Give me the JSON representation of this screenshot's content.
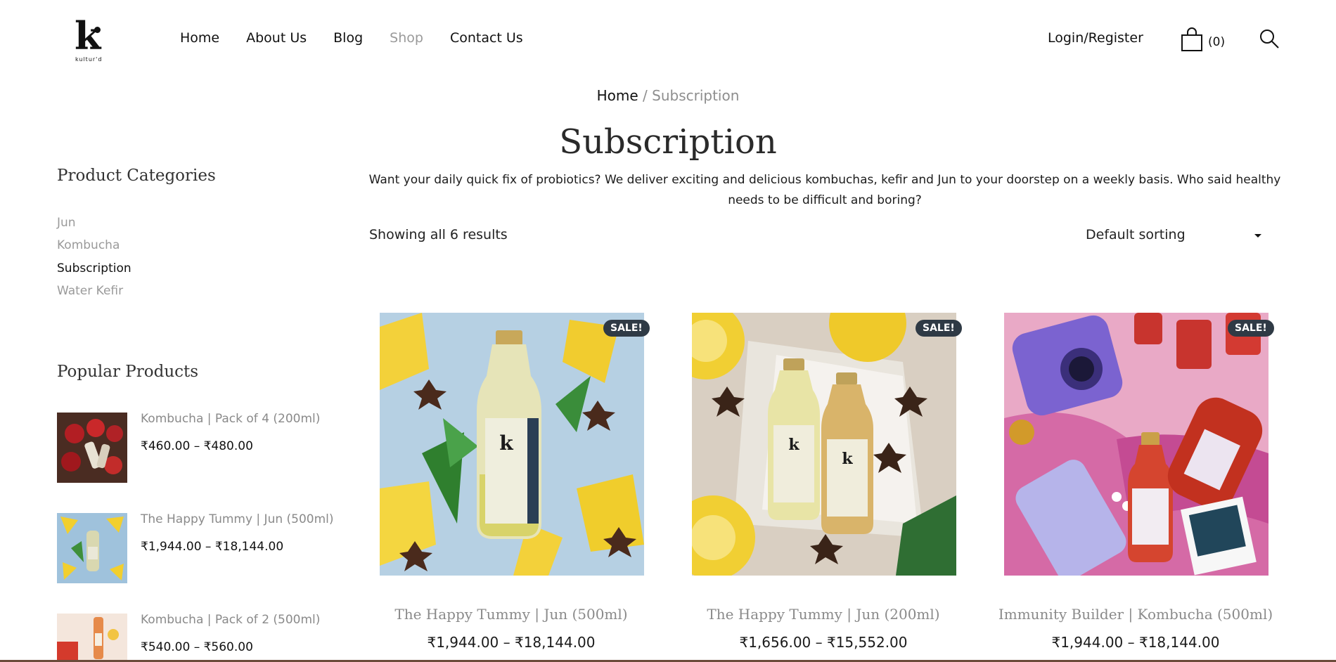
{
  "header": {
    "logo_text": "kultur'd",
    "nav": [
      "Home",
      "About Us",
      "Blog",
      "Shop",
      "Contact Us"
    ],
    "active_nav": "Shop",
    "login_label": "Login/Register",
    "cart_count": "(0)"
  },
  "breadcrumb": {
    "home": "Home",
    "separator": "/",
    "current": "Subscription"
  },
  "page": {
    "title": "Subscription",
    "description": "Want your daily quick fix of probiotics? We deliver exciting and delicious kombuchas, kefir and Jun to your doorstep on a weekly basis. Who said healthy needs to be difficult and boring?",
    "results_text": "Showing all 6 results",
    "sort_label": "Default sorting"
  },
  "sidebar": {
    "categories_heading": "Product Categories",
    "categories": [
      {
        "label": "Jun",
        "active": false
      },
      {
        "label": "Kombucha",
        "active": false
      },
      {
        "label": "Subscription",
        "active": true
      },
      {
        "label": "Water Kefir",
        "active": false
      }
    ],
    "popular_heading": "Popular Products",
    "popular": [
      {
        "name": "Kombucha | Pack of 4 (200ml)",
        "price": "₹460.00 – ₹480.00"
      },
      {
        "name": "The Happy Tummy | Jun (500ml)",
        "price": "₹1,944.00 – ₹18,144.00"
      },
      {
        "name": "Kombucha | Pack of 2 (500ml)",
        "price": "₹540.00 – ₹560.00"
      }
    ]
  },
  "products": [
    {
      "name": "The Happy Tummy | Jun (500ml)",
      "price": "₹1,944.00 – ₹18,144.00",
      "badge": "SALE!"
    },
    {
      "name": "The Happy Tummy | Jun (200ml)",
      "price": "₹1,656.00 – ₹15,552.00",
      "badge": "SALE!"
    },
    {
      "name": "Immunity Builder | Kombucha (500ml)",
      "price": "₹1,944.00 – ₹18,144.00",
      "badge": "SALE!"
    }
  ],
  "colors": {
    "accent_muted": "#9a9a9a",
    "badge": "#2f3a45",
    "text": "#111111"
  }
}
